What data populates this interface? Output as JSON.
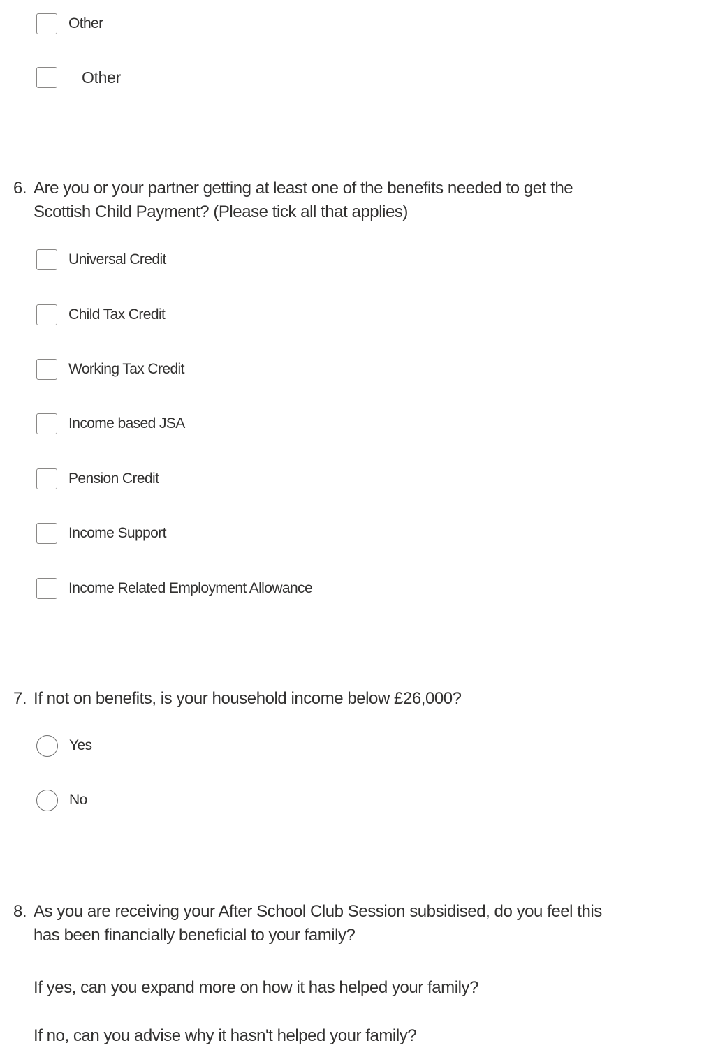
{
  "q5_tail": {
    "options": [
      {
        "label": "Other",
        "checked": false
      },
      {
        "label": "Other",
        "checked": false
      }
    ]
  },
  "q6": {
    "number": "6.",
    "text_line1": "Are you or your partner getting at least one of the benefits needed to get the",
    "text_line2": "Scottish Child Payment? (Please tick all that applies)",
    "options": [
      {
        "label": "Universal Credit",
        "checked": false
      },
      {
        "label": "Child Tax Credit",
        "checked": false
      },
      {
        "label": "Working Tax Credit",
        "checked": false
      },
      {
        "label": "Income based JSA",
        "checked": false
      },
      {
        "label": "Pension Credit",
        "checked": false
      },
      {
        "label": "Income Support",
        "checked": false
      },
      {
        "label": "Income Related Employment Allowance",
        "checked": false
      }
    ]
  },
  "q7": {
    "number": "7.",
    "text": "If not on benefits, is your household income below £26,000?",
    "options": [
      {
        "label": "Yes",
        "selected": false
      },
      {
        "label": "No",
        "selected": false
      }
    ]
  },
  "q8": {
    "number": "8.",
    "text_line1": "As you are receiving your After School Club Session subsidised, do you feel this",
    "text_line2": "has been financially beneficial to your family?",
    "sub1": "If yes, can you expand more on how it has helped your family?",
    "sub2": "If no, can you advise why it hasn't helped your family?"
  },
  "colors": {
    "text": "#323130",
    "control_border": "#8a8886",
    "background": "#ffffff"
  }
}
